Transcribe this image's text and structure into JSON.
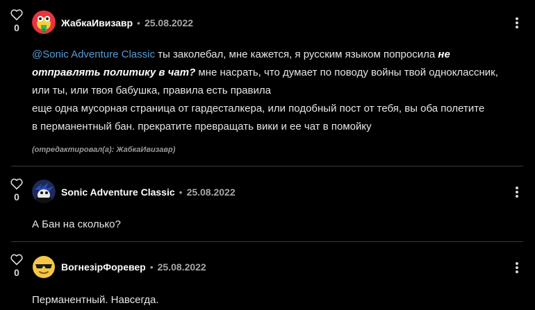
{
  "comments": [
    {
      "author": "ЖабкаИвизавр",
      "separator": "•",
      "date": "25.08.2022",
      "votes": "0",
      "avatar_icon": "frog-avatar",
      "mention": "@Sonic Adventure Classic",
      "text_1": " ты заколебал, мне кажется, я русским языком попросила ",
      "emphasis_1": "не",
      "emphasis_2": "отправлять политику в чат?",
      "text_2": " мне насрать, что думает по поводу войны твой одноклассник,",
      "text_3": "или ты, или твоя бабушка, правила есть правила",
      "text_4": "еще одна мусорная страница от гардесталкера, или подобный пост от тебя, вы оба полетите",
      "text_5": "в перманентный бан. прекратите превращать вики и ее чат в помойку",
      "edited_note": "(отредактировал(а): ЖабкаИвизавр)"
    },
    {
      "author": "Sonic Adventure Classic",
      "separator": "•",
      "date": "25.08.2022",
      "votes": "0",
      "avatar_icon": "sonic-avatar",
      "text": "А Бан на сколько?"
    },
    {
      "author": "ВогнезірФоревер",
      "separator": "•",
      "date": "25.08.2022",
      "votes": "0",
      "avatar_icon": "sunglasses-emoji-avatar",
      "text": "Перманентный. Навсегда."
    }
  ],
  "colors": {
    "background": "#000000",
    "mention": "#5b9bd5",
    "divider": "#3a3a3a"
  }
}
